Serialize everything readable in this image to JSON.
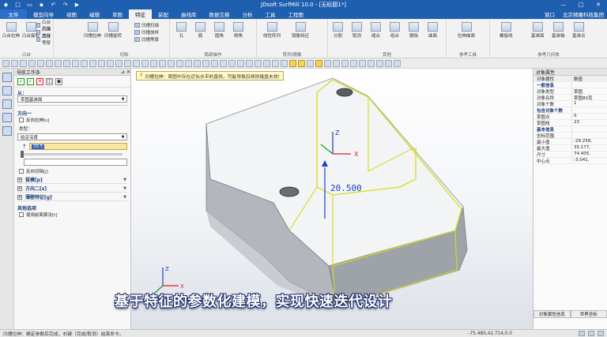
{
  "window": {
    "title": "JDsoft SurfMill 10.0 - [无标题1*]"
  },
  "menu": {
    "file": "文件",
    "items": [
      "模型向导",
      "视图",
      "编辑",
      "草图",
      "特征",
      "装配",
      "曲线库",
      "数据交换",
      "分析",
      "工具",
      "工程图"
    ],
    "active_index": 4,
    "right": {
      "window": "窗口",
      "company": "北京精雕科技集团"
    }
  },
  "ribbon": {
    "groups": [
      {
        "name": "凸台",
        "buttons": [
          "凸台拉伸",
          "凸台旋转"
        ],
        "small": [
          "凸台扫描",
          "凸台放样",
          "凸台等厚"
        ]
      },
      {
        "name": "切除",
        "buttons": [
          "凹槽拉伸",
          "凹槽旋转"
        ],
        "small": [
          "凹槽扫描",
          "凹槽放样",
          "凹槽等厚"
        ]
      },
      {
        "name": "局部操作",
        "buttons": [
          "孔",
          "筋",
          "圆角",
          "倒角",
          "抽壳",
          "拔模"
        ]
      },
      {
        "name": "阵列/镜像",
        "buttons": [
          "线性阵列",
          "镜像特征"
        ]
      },
      {
        "name": "其他",
        "buttons": [
          "分割",
          "取消",
          "缝合",
          "组合",
          "删除",
          "曲面"
        ]
      },
      {
        "name": "参考工具",
        "buttons": [
          "拉伸曲面"
        ]
      },
      {
        "name": "参考几何体",
        "buttons": [
          "螺旋线",
          "基准面",
          "基准轴",
          "基准点"
        ]
      }
    ]
  },
  "panel": {
    "title": "导航工作条",
    "from_label": "从：",
    "from_value": "草图基准面",
    "dir1_label": "方向一",
    "reverse_label": "反向拉伸[s]",
    "type_label": "类型：",
    "type_value": "给定深度",
    "depth_value": "20.5",
    "reverse_cut_label": "反向切除[j]",
    "collapsed": [
      "拔模[p]",
      "方向二[z]",
      "薄壁特征[g]"
    ],
    "other_label": "其他选项",
    "cutting_label": "使用前面算法[t]"
  },
  "viewport": {
    "hint": "凹槽拉伸：草图中存在近似水平的直线，可能导致后续修缝盘未效!",
    "dimension": "20.500",
    "subtitle": "基于特征的参数化建模，实现快速迭代设计",
    "axis_labels": {
      "x": "X",
      "y": "Y",
      "z": "Z"
    }
  },
  "props": {
    "title": "对象属性",
    "header": [
      "对象属性",
      "数值"
    ],
    "rows": [
      {
        "k": "一般信息",
        "v": "",
        "cat": true
      },
      {
        "k": "对象类型",
        "v": "草图"
      },
      {
        "k": "对象名称",
        "v": "草图80克"
      },
      {
        "k": "对象个数",
        "v": "1"
      },
      {
        "k": "包含对象个数",
        "v": "",
        "cat": true
      },
      {
        "k": "草图点",
        "v": "0"
      },
      {
        "k": "草图线",
        "v": "23"
      },
      {
        "k": "基本信息",
        "v": "",
        "cat": true
      },
      {
        "k": "坐标范围",
        "v": ""
      },
      {
        "k": "最小值",
        "v": "-29.258,"
      },
      {
        "k": "最大值",
        "v": "35.177,"
      },
      {
        "k": "尺寸",
        "v": "74.405,"
      },
      {
        "k": "中心点",
        "v": "-3.041,"
      }
    ],
    "bottom_tabs": [
      "对象属性信息",
      "世界坐标"
    ]
  },
  "status": {
    "text": "凹槽拉伸：确定参数后完成，右键（完成/取消）结束命令。",
    "coord": "-75.480,42.714,0.0"
  }
}
